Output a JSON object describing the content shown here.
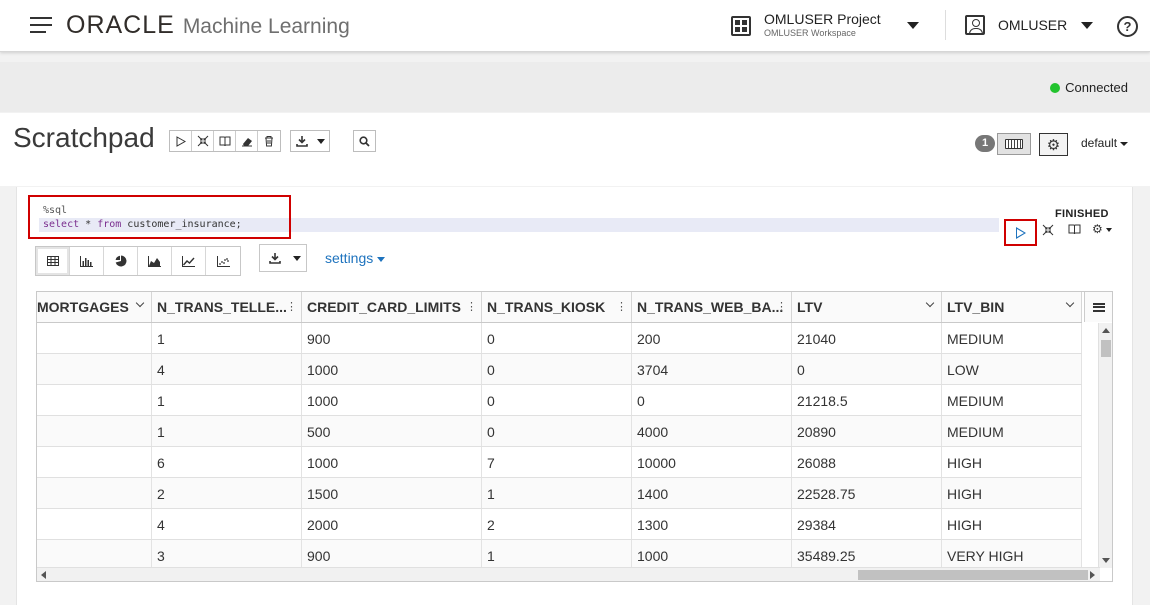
{
  "header": {
    "brand_oracle": "ORACLE",
    "brand_product": "Machine Learning",
    "project_name": "OMLUSER Project",
    "workspace_name": "OMLUSER Workspace",
    "user_name": "OMLUSER",
    "help_glyph": "?"
  },
  "status": {
    "text": "Connected",
    "color": "#22c32e"
  },
  "notebook": {
    "title": "Scratchpad",
    "paragraph_count": "1",
    "interpreter_binding": "default"
  },
  "paragraph": {
    "code_line1": "%sql",
    "code_kw1": "select",
    "code_mid": " * ",
    "code_kw2": "from",
    "code_rest": " customer_insurance;",
    "status": "FINISHED",
    "settings_label": "settings"
  },
  "icons": {
    "toolbar": [
      "run-all-icon",
      "collapse-icon",
      "book-icon",
      "eraser-icon",
      "trash-icon"
    ],
    "viz": [
      "table-icon",
      "bar-chart-icon",
      "pie-chart-icon",
      "area-chart-icon",
      "line-chart-icon",
      "scatter-chart-icon"
    ]
  },
  "table": {
    "columns": [
      "MORTGAGES",
      "N_TRANS_TELLE...",
      "CREDIT_CARD_LIMITS",
      "N_TRANS_KIOSK",
      "N_TRANS_WEB_BA...",
      "LTV",
      "LTV_BIN"
    ],
    "rows": [
      [
        "",
        "1",
        "900",
        "0",
        "200",
        "21040",
        "MEDIUM"
      ],
      [
        "",
        "4",
        "1000",
        "0",
        "3704",
        "0",
        "LOW"
      ],
      [
        "",
        "1",
        "1000",
        "0",
        "0",
        "21218.5",
        "MEDIUM"
      ],
      [
        "",
        "1",
        "500",
        "0",
        "4000",
        "20890",
        "MEDIUM"
      ],
      [
        "",
        "6",
        "1000",
        "7",
        "10000",
        "26088",
        "HIGH"
      ],
      [
        "",
        "2",
        "1500",
        "1",
        "1400",
        "22528.75",
        "HIGH"
      ],
      [
        "",
        "4",
        "2000",
        "2",
        "1300",
        "29384",
        "HIGH"
      ],
      [
        "",
        "3",
        "900",
        "1",
        "1000",
        "35489.25",
        "VERY HIGH"
      ]
    ]
  },
  "colors": {
    "highlight": "#d00000",
    "accent": "#1e73be"
  }
}
